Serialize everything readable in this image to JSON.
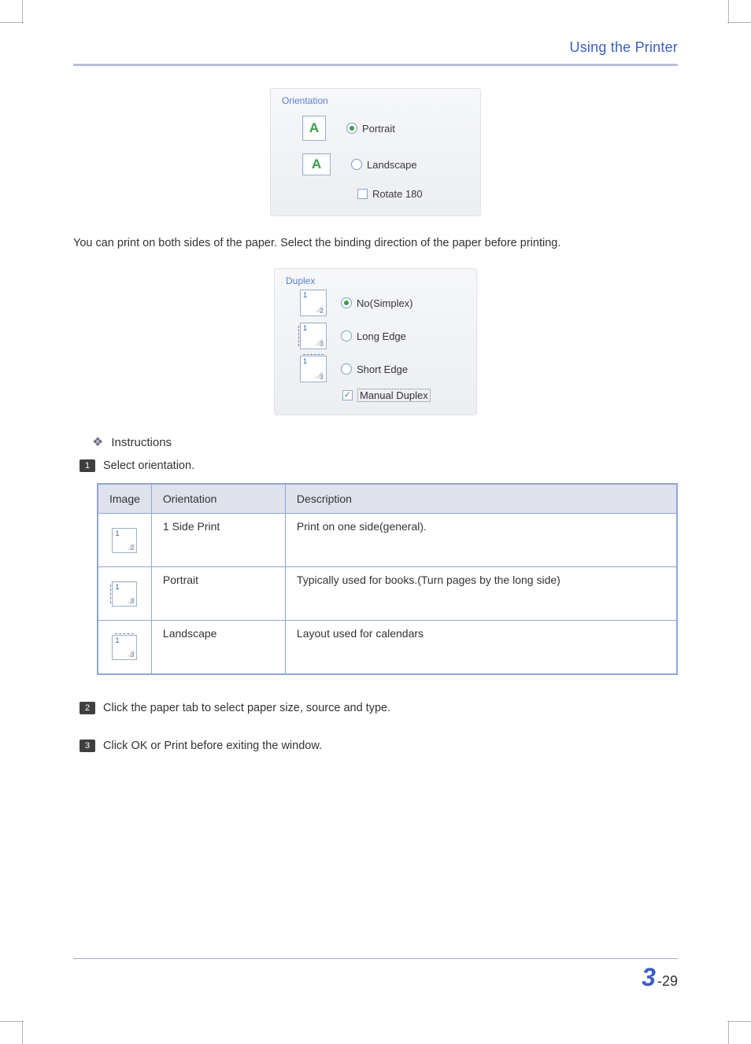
{
  "header": {
    "title": "Using the Printer"
  },
  "orientation_panel": {
    "legend": "Orientation",
    "options": {
      "portrait": {
        "label": "Portrait",
        "selected": true,
        "glyph": "A"
      },
      "landscape": {
        "label": "Landscape",
        "selected": false,
        "glyph": "A"
      },
      "rotate180": {
        "label": "Rotate 180",
        "checked": false
      }
    }
  },
  "paragraph1": "You can print on both sides of the paper. Select the binding direction of the paper before printing.",
  "duplex_panel": {
    "legend": "Duplex",
    "options": {
      "no_simplex": {
        "label": "No(Simplex)",
        "selected": true
      },
      "long_edge": {
        "label": "Long Edge",
        "selected": false
      },
      "short_edge": {
        "label": "Short Edge",
        "selected": false
      },
      "manual_duplex": {
        "label": "Manual Duplex",
        "checked": true
      }
    }
  },
  "instructions": {
    "heading": "Instructions",
    "steps": [
      {
        "num": "1",
        "text": "Select orientation."
      },
      {
        "num": "2",
        "text": "Click the paper tab to select paper size, source and type."
      },
      {
        "num": "3",
        "text": "Click OK or Print before exiting the window."
      }
    ]
  },
  "table": {
    "headers": {
      "image": "Image",
      "orientation": "Orientation",
      "description": "Description"
    },
    "rows": [
      {
        "orientation": "1 Side Print",
        "description": "Print on one side(general)."
      },
      {
        "orientation": "Portrait",
        "description": "Typically used for books.(Turn pages by the long side)"
      },
      {
        "orientation": "Landscape",
        "description": "Layout used for calendars"
      }
    ]
  },
  "footer": {
    "chapter": "3",
    "sep": "-",
    "page": "29"
  }
}
